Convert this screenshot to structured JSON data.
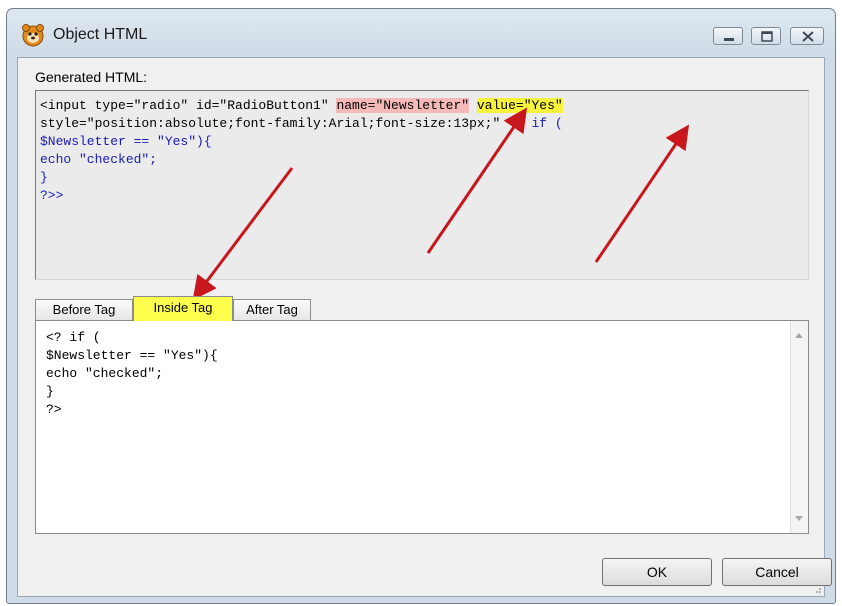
{
  "window": {
    "title": "Object HTML",
    "icon": "app-icon"
  },
  "generated": {
    "label": "Generated HTML:",
    "line1_a": "<input type=\"radio\" id=\"RadioButton1\" ",
    "line1_name": "name=\"Newsletter\"",
    "line1_space": " ",
    "line1_value": "value=\"Yes\"",
    "line2_a": "style=\"position:absolute;font-family:Arial;font-size:13px;\" ",
    "line2_php": "<? if (",
    "line3": "$Newsletter == \"Yes\"){",
    "line4": "echo \"checked\";",
    "line5": "}",
    "line6": "?>>"
  },
  "tabs": {
    "before": "Before Tag",
    "inside": "Inside Tag",
    "after": "After Tag"
  },
  "inside_tag_code": "<? if (\n$Newsletter == \"Yes\"){\necho \"checked\";\n}\n?>",
  "buttons": {
    "ok": "OK",
    "cancel": "Cancel"
  },
  "colors": {
    "name_highlight": "#f6b9b9",
    "value_highlight": "#f7f23b",
    "inside_tab_highlight": "#ffff4d",
    "arrow": "#c8171c"
  }
}
